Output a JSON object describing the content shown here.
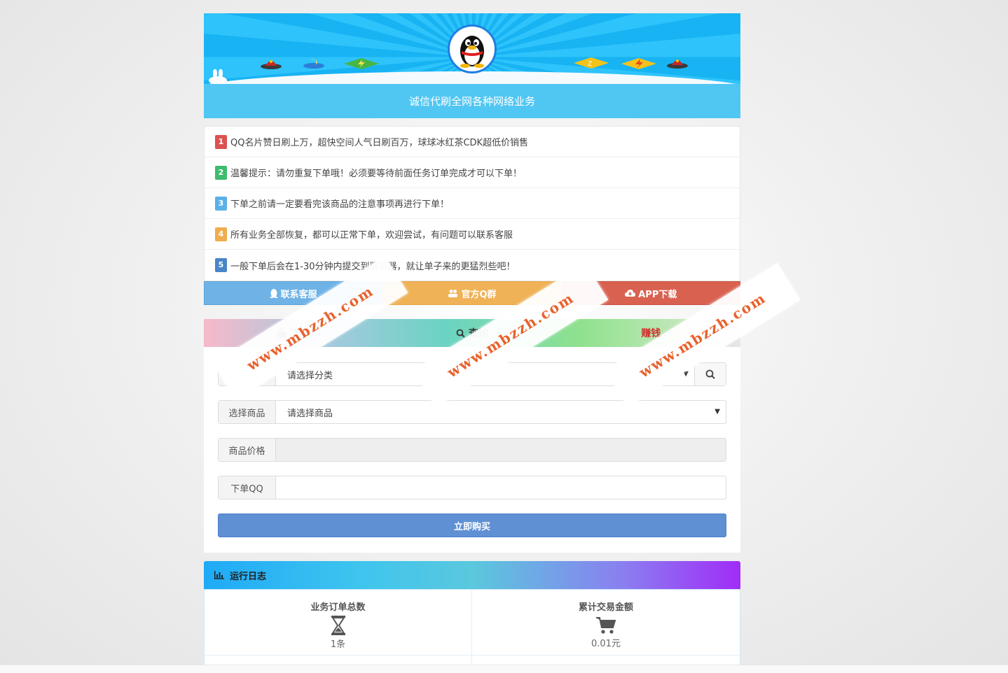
{
  "banner": {
    "title": "诚信代刷全网各种网络业务",
    "logo_icon": "qq-penguin-icon"
  },
  "notices": [
    {
      "num": "1",
      "color": "#d9534f",
      "text": "QQ名片赞日刷上万，超快空间人气日刷百万，球球冰红茶CDK超低价销售"
    },
    {
      "num": "2",
      "color": "#3dbc6e",
      "text": "温馨提示：请勿重复下单哦！必须要等待前面任务订单完成才可以下单！"
    },
    {
      "num": "3",
      "color": "#5bb0e6",
      "text": "下单之前请一定要看完该商品的注意事项再进行下单！"
    },
    {
      "num": "4",
      "color": "#f0ad4e",
      "text": "所有业务全部恢复，都可以正常下单，欢迎尝试，有问题可以联系客服"
    },
    {
      "num": "5",
      "color": "#4a86c8",
      "text": "一般下单后会在1-30分钟内提交到服务器，就让单子来的更猛烈些吧！"
    }
  ],
  "contact": {
    "service": {
      "label": "联系客服",
      "icon": "qq-icon",
      "color": "#6fb3e6"
    },
    "group": {
      "label": "官方Q群",
      "icon": "users-icon",
      "color": "#efb256"
    },
    "app": {
      "label": "APP下载",
      "icon": "cloud-download-icon",
      "color": "#d9614f"
    }
  },
  "tabs": {
    "order": {
      "label": "下单",
      "icon": "shopping-bag-icon"
    },
    "query": {
      "label": "查询",
      "icon": "search-icon"
    },
    "third": {
      "label": "赚钱",
      "icon": "money-icon"
    }
  },
  "form": {
    "category": {
      "label": "",
      "value": "请选择分类"
    },
    "product": {
      "label": "选择商品",
      "value": "请选择商品"
    },
    "price": {
      "label": "商品价格",
      "value": ""
    },
    "qq": {
      "label": "下单QQ",
      "value": ""
    },
    "buy_label": "立即购买"
  },
  "log": {
    "title": "运行日志",
    "icon": "bar-chart-icon",
    "stats": [
      {
        "title": "业务订单总数",
        "value": "1条",
        "icon": "hourglass-icon"
      },
      {
        "title": "累计交易金额",
        "value": "0.01元",
        "icon": "cart-icon"
      }
    ]
  },
  "watermark": "www.mbzzh.com"
}
